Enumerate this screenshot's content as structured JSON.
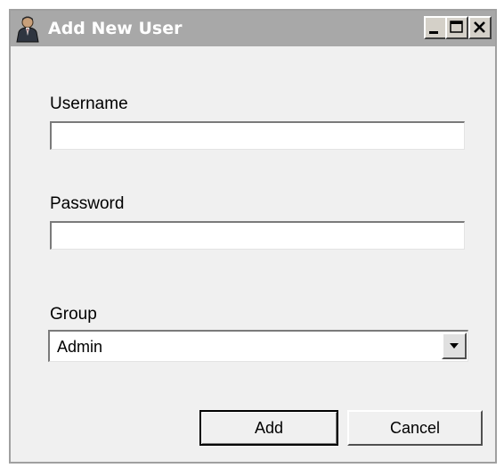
{
  "window": {
    "title": "Add New User",
    "icon": "user-icon",
    "controls": {
      "minimize_icon": "minimize-icon",
      "maximize_icon": "maximize-icon",
      "close_icon": "close-icon"
    }
  },
  "form": {
    "username": {
      "label": "Username",
      "value": ""
    },
    "password": {
      "label": "Password",
      "value": ""
    },
    "group": {
      "label": "Group",
      "selected": "Admin",
      "dropdown_icon": "chevron-down-icon"
    }
  },
  "buttons": {
    "add_label": "Add",
    "cancel_label": "Cancel"
  },
  "colors": {
    "titlebar": "#a8a8a8",
    "window_background": "#f0f0f0",
    "field_background": "#ffffff"
  }
}
